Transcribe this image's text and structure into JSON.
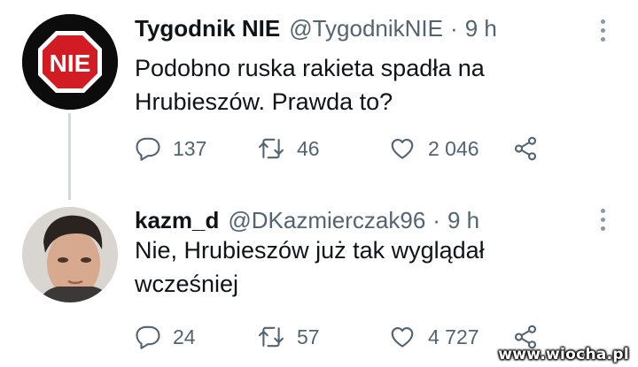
{
  "tweets": [
    {
      "display_name": "Tygodnik NIE",
      "handle": "@TygodnikNIE",
      "separator": "·",
      "time": "9 h",
      "avatar_text": "NIE",
      "text": "Podobno ruska rakieta spadła na\nHrubieszów. Prawda to?",
      "replies": "137",
      "retweets": "46",
      "likes": "2 046"
    },
    {
      "display_name": "kazm_d",
      "handle": "@DKazmierczak96",
      "separator": "·",
      "time": "9 h",
      "text": "Nie, Hrubieszów już tak wyglądał\nwcześniej",
      "replies": "24",
      "retweets": "57",
      "likes": "4 727"
    }
  ],
  "watermark": "www.wiocha.pl",
  "icons": {
    "reply": "speech-bubble-icon",
    "retweet": "retweet-arrows-icon",
    "like": "heart-icon",
    "share": "share-nodes-icon",
    "more": "vertical-dots-icon"
  },
  "colors": {
    "stop_sign_red": "#d01c22",
    "secondary_text": "#536471",
    "thread_line": "#cfd9de"
  }
}
